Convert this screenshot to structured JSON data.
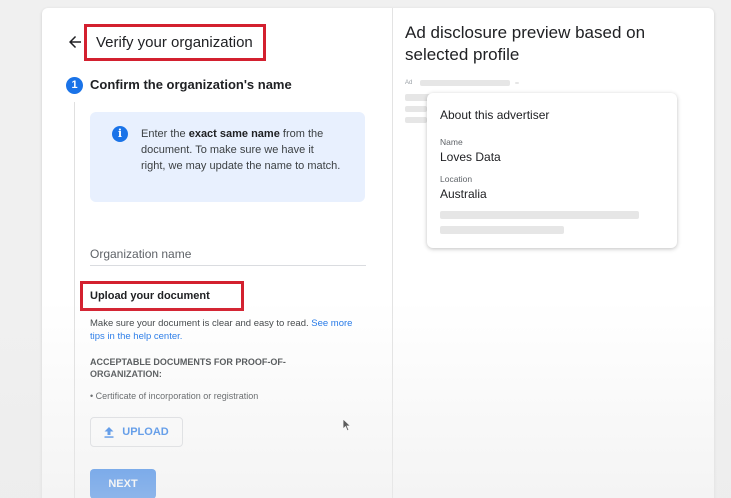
{
  "header": {
    "title": "Verify your organization",
    "back_icon": "arrow-left-icon"
  },
  "step": {
    "number": "1",
    "title": "Confirm the organization's name"
  },
  "info": {
    "icon": "info-icon",
    "text_pre": "Enter the ",
    "text_bold": "exact same name",
    "text_post": " from the document. To make sure we have it right, we may update the name to match."
  },
  "org_field": {
    "label": "Organization name",
    "value": ""
  },
  "upload": {
    "title": "Upload your document",
    "description": "Make sure your document is clear and easy to read. ",
    "link_text": "See more tips in the help center.",
    "accept_heading": "ACCEPTABLE DOCUMENTS FOR PROOF-OF-ORGANIZATION:",
    "accepted_items": [
      "Certificate of incorporation or registration"
    ],
    "button_label": "UPLOAD",
    "button_icon": "upload-icon"
  },
  "next_button": {
    "label": "NEXT"
  },
  "preview": {
    "title": "Ad disclosure preview based on selected profile",
    "ad_label": "Ad",
    "card": {
      "title": "About this advertiser",
      "name_label": "Name",
      "name_value": "Loves Data",
      "location_label": "Location",
      "location_value": "Australia"
    }
  },
  "colors": {
    "accent": "#1a73e8",
    "highlight_box": "#d3202f",
    "info_bg": "#e8f0fe"
  }
}
